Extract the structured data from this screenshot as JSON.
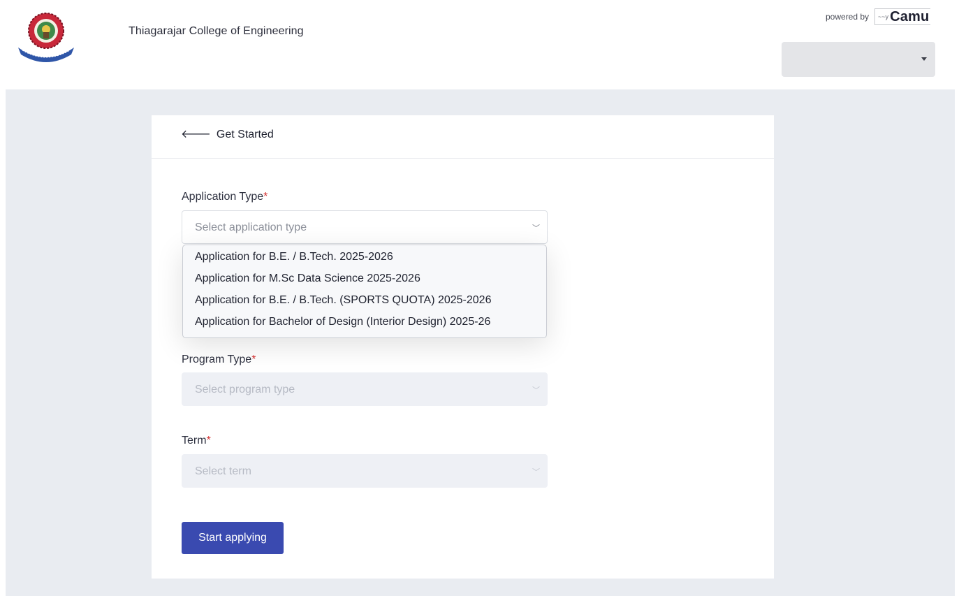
{
  "header": {
    "college_name": "Thiagarajar College of Engineering",
    "powered_by": "powered by",
    "brand_word": "Camu",
    "brand_mark": "~~y",
    "user_menu_value": "",
    "logo_icon": "college-emblem"
  },
  "card": {
    "back_label": "Get Started",
    "back_icon": "arrow-left-icon"
  },
  "form": {
    "application_type": {
      "label": "Application Type",
      "required_mark": "*",
      "placeholder": "Select application type",
      "options": [
        "Application for B.E. / B.Tech. 2025-2026",
        "Application for M.Sc Data Science 2025-2026",
        "Application for B.E. / B.Tech. (SPORTS QUOTA) 2025-2026",
        "Application for Bachelor of Design (Interior Design) 2025-26"
      ],
      "expanded": true
    },
    "program_type": {
      "label": "Program Type",
      "required_mark": "*",
      "placeholder": "Select program type",
      "disabled": true
    },
    "term": {
      "label": "Term",
      "required_mark": "*",
      "placeholder": "Select term",
      "disabled": true
    },
    "submit_label": "Start applying"
  },
  "colors": {
    "primary": "#3a4ab0",
    "required": "#d32f2f",
    "page_bg": "#e9ecf1",
    "disabled_field": "#eef0f5"
  }
}
